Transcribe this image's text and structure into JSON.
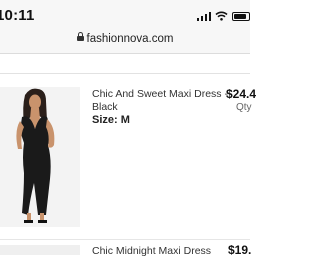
{
  "status_bar": {
    "time": "10:11",
    "icons": [
      "signal-icon",
      "wifi-icon",
      "battery-icon"
    ]
  },
  "browser": {
    "url": "fashionnova.com",
    "lock_icon": "lock-icon"
  },
  "cart": {
    "items": [
      {
        "name": "Chic And Sweet Maxi Dress - Black",
        "size_label": "Size: M",
        "price": "$24.4",
        "qty_label": "Qty"
      },
      {
        "name": "Chic Midnight Maxi Dress",
        "price": "$19."
      }
    ]
  },
  "colors": {
    "page_bg": "#ffffff",
    "bar_bg": "#f7f7f7",
    "dress": "#1a1a1a"
  }
}
